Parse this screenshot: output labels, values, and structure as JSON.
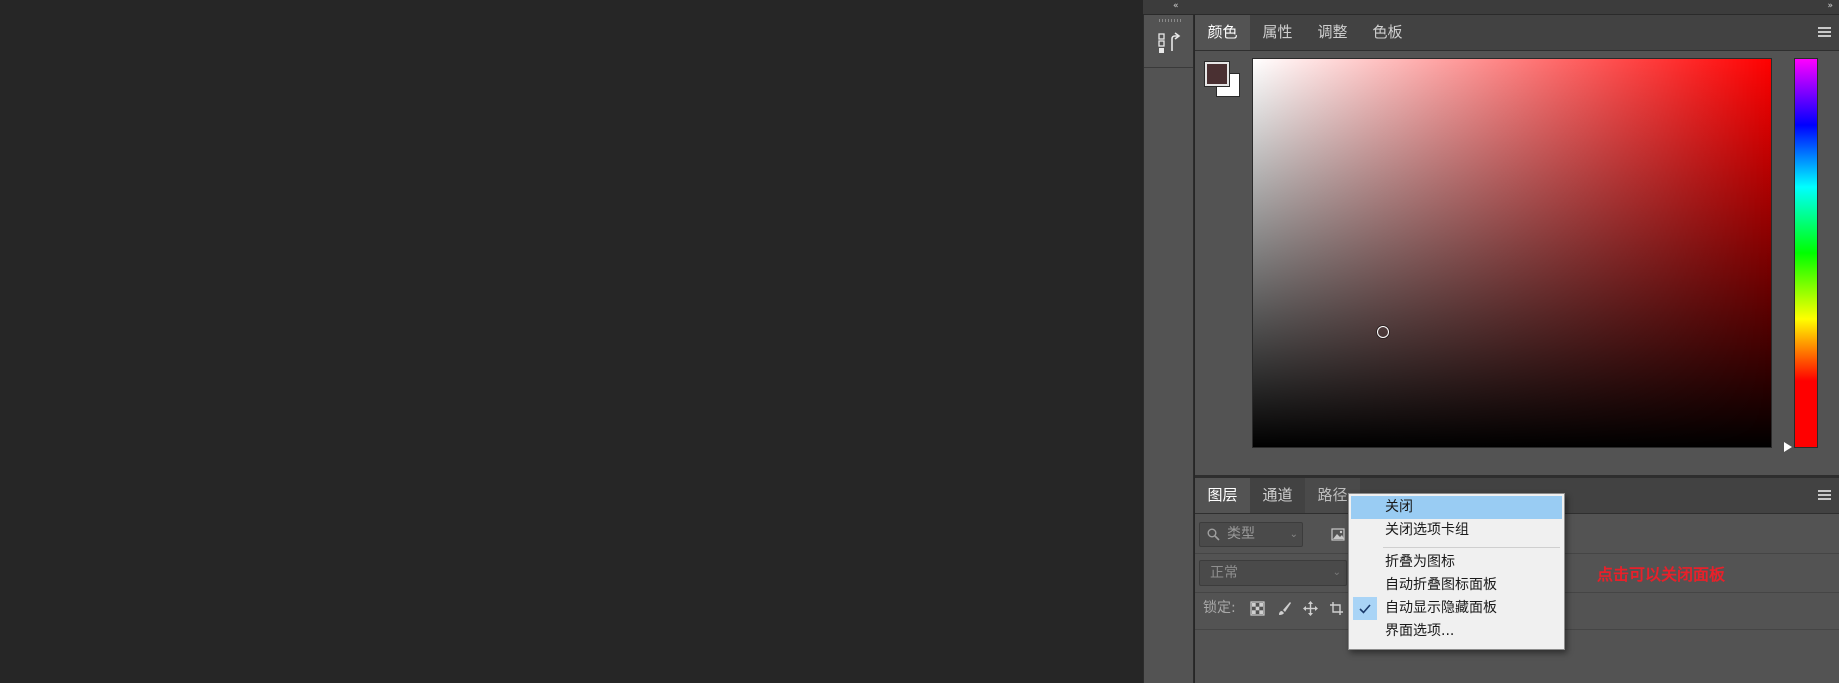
{
  "dock": {
    "history_icon": "history-panel-icon"
  },
  "color_panel": {
    "tabs": [
      {
        "label": "颜色",
        "active": true
      },
      {
        "label": "属性",
        "active": false
      },
      {
        "label": "调整",
        "active": false
      },
      {
        "label": "色板",
        "active": false
      }
    ],
    "foreground_color": "#4a3032",
    "background_color": "#ffffff",
    "hue_color": "#ff0000",
    "hue_position": 0.0,
    "saturation": 0.25,
    "brightness": 0.3
  },
  "layers_panel": {
    "tabs": [
      {
        "label": "图层",
        "active": true
      },
      {
        "label": "通道",
        "active": false
      },
      {
        "label": "路径",
        "active": false
      }
    ],
    "filter": {
      "placeholder": "类型"
    },
    "blend_mode": "正常",
    "lock_label": "锁定:"
  },
  "context_menu": {
    "items": [
      {
        "label": "关闭",
        "highlighted": true,
        "checked": false
      },
      {
        "label": "关闭选项卡组",
        "highlighted": false,
        "checked": false
      },
      {
        "label": "折叠为图标",
        "highlighted": false,
        "checked": false
      },
      {
        "label": "自动折叠图标面板",
        "highlighted": false,
        "checked": false
      },
      {
        "label": "自动显示隐藏面板",
        "highlighted": false,
        "checked": true
      },
      {
        "label": "界面选项...",
        "highlighted": false,
        "checked": false
      }
    ]
  },
  "annotation": {
    "text": "点击可以关闭面板",
    "color": "#e8202a"
  },
  "icons": {
    "collapse_left": "«",
    "collapse_right": "»",
    "menu": "hamburger-icon"
  }
}
